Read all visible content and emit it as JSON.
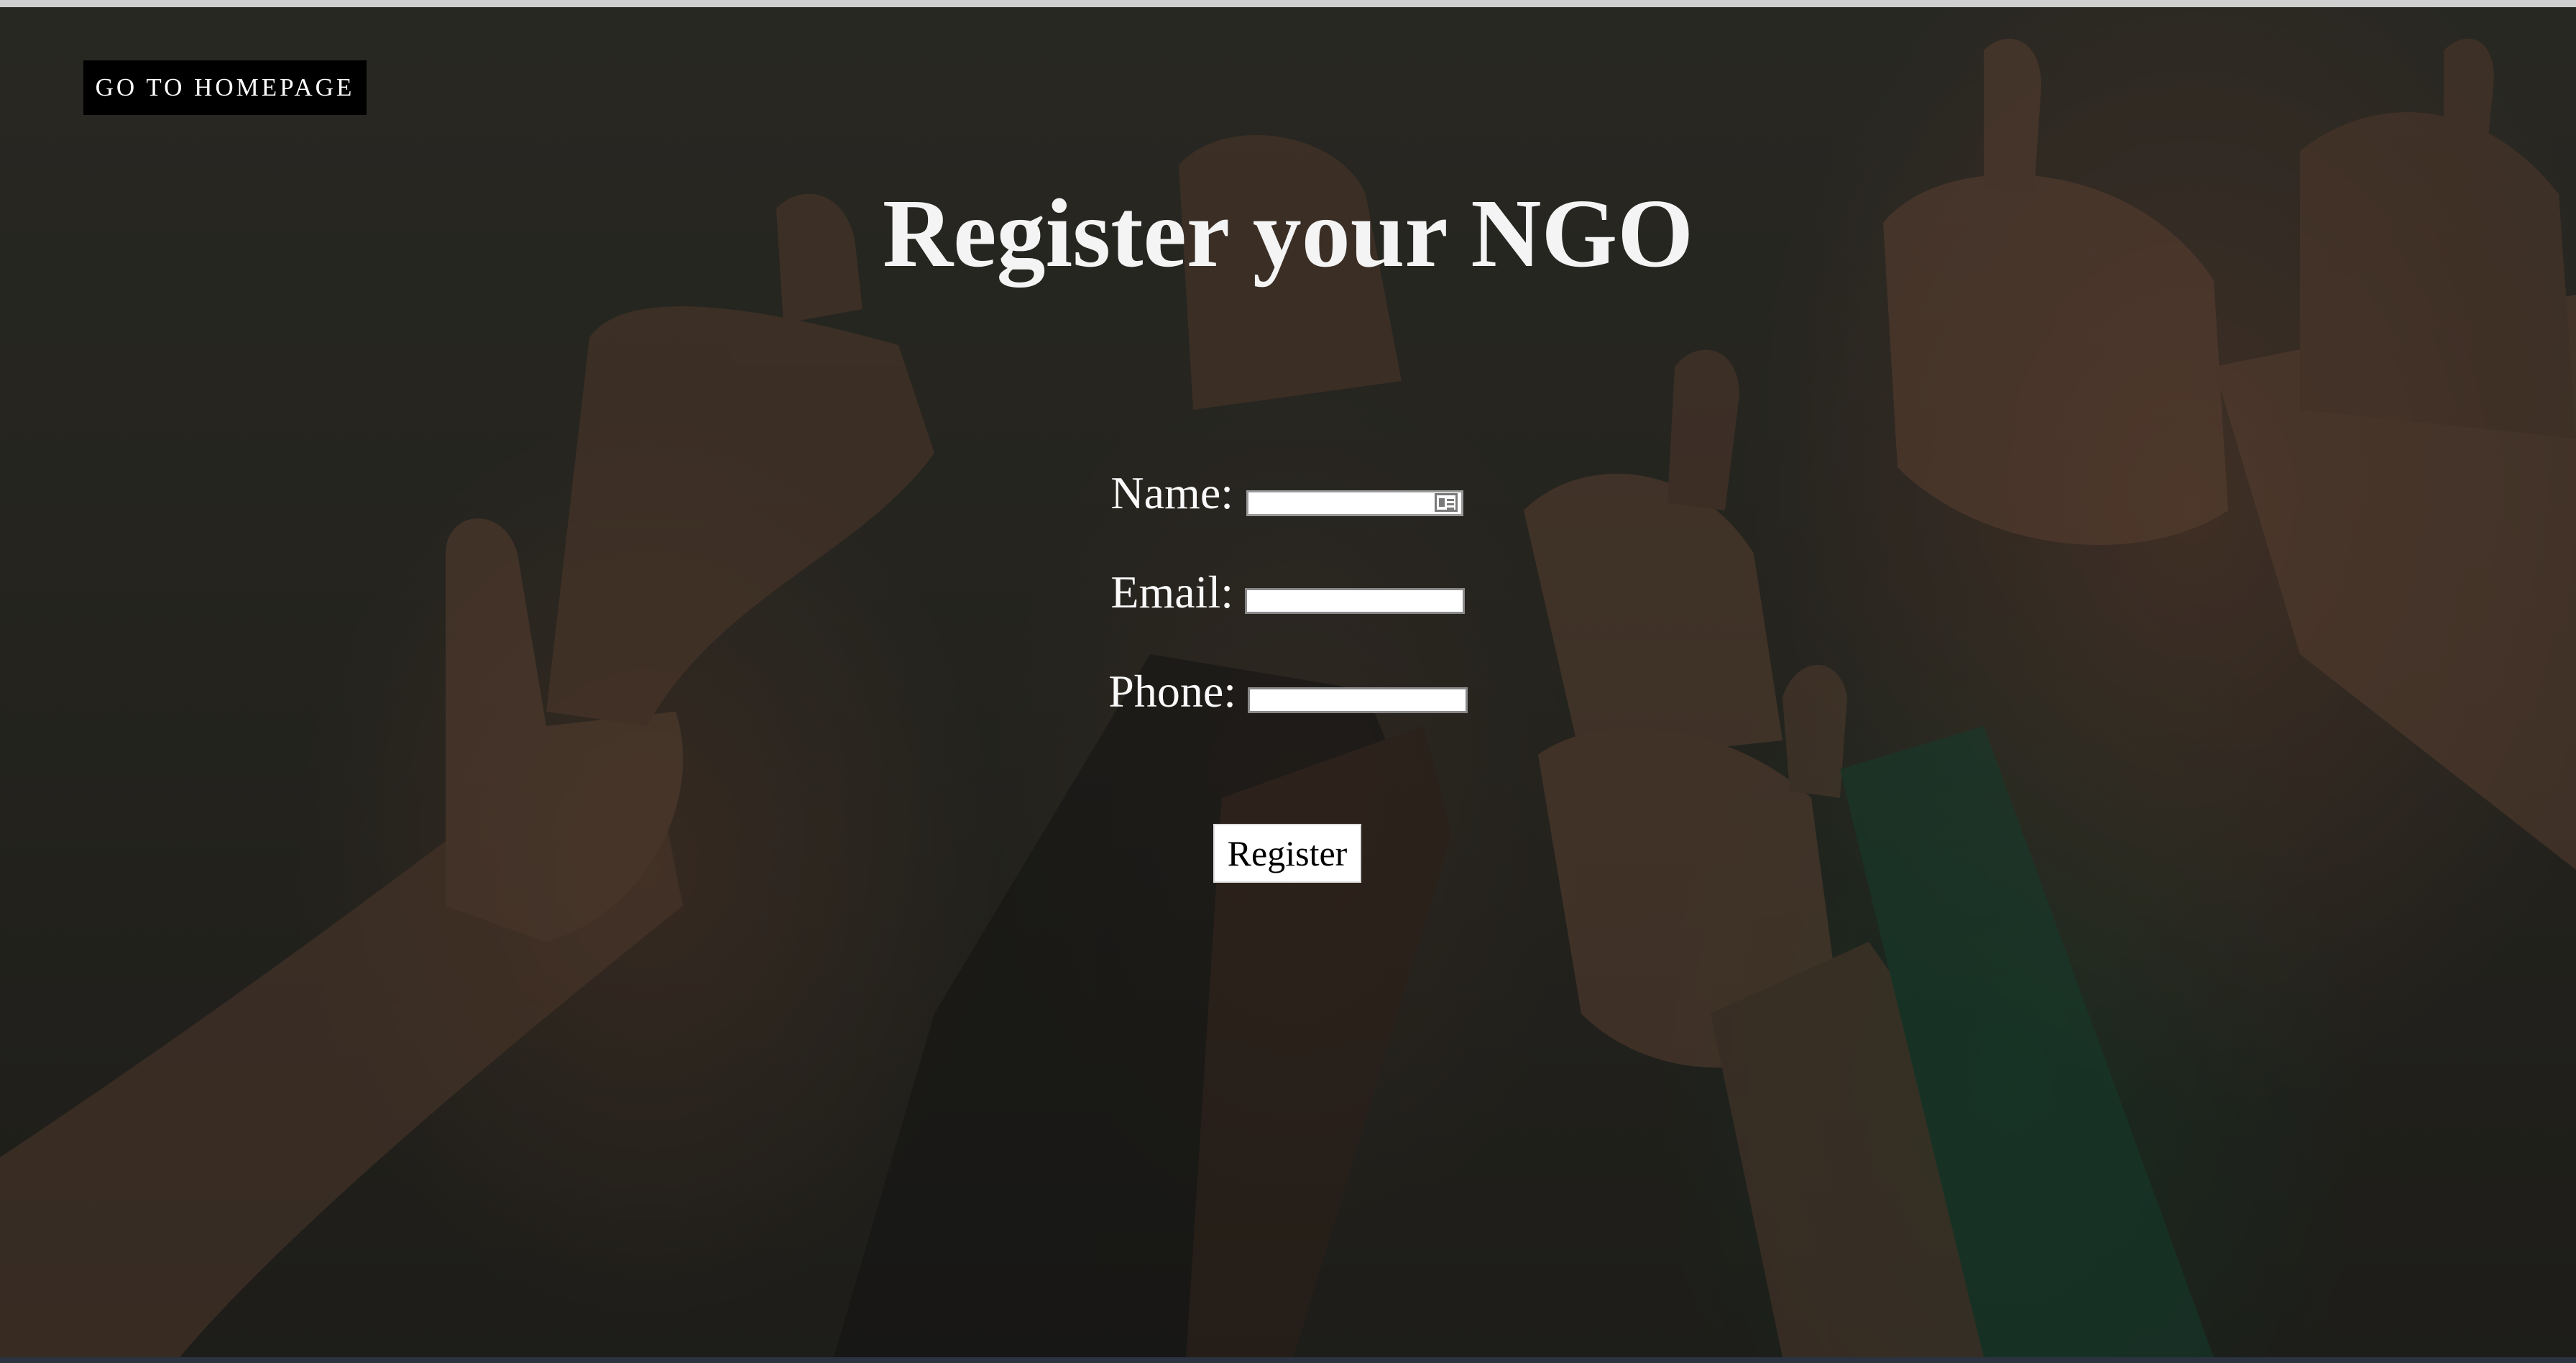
{
  "nav": {
    "home_label": "GO TO HOMEPAGE"
  },
  "page": {
    "title": "Register your NGO"
  },
  "form": {
    "name_label": "Name:",
    "name_value": "",
    "email_label": "Email:",
    "email_value": "",
    "phone_label": "Phone:",
    "phone_value": "",
    "submit_label": "Register"
  },
  "icons": {
    "autofill": "contact-card-icon"
  },
  "colors": {
    "title_text": "#f4f4f4",
    "button_dark": "#000000",
    "button_light": "#ffffff",
    "background_overlay": "#2c2b25"
  }
}
